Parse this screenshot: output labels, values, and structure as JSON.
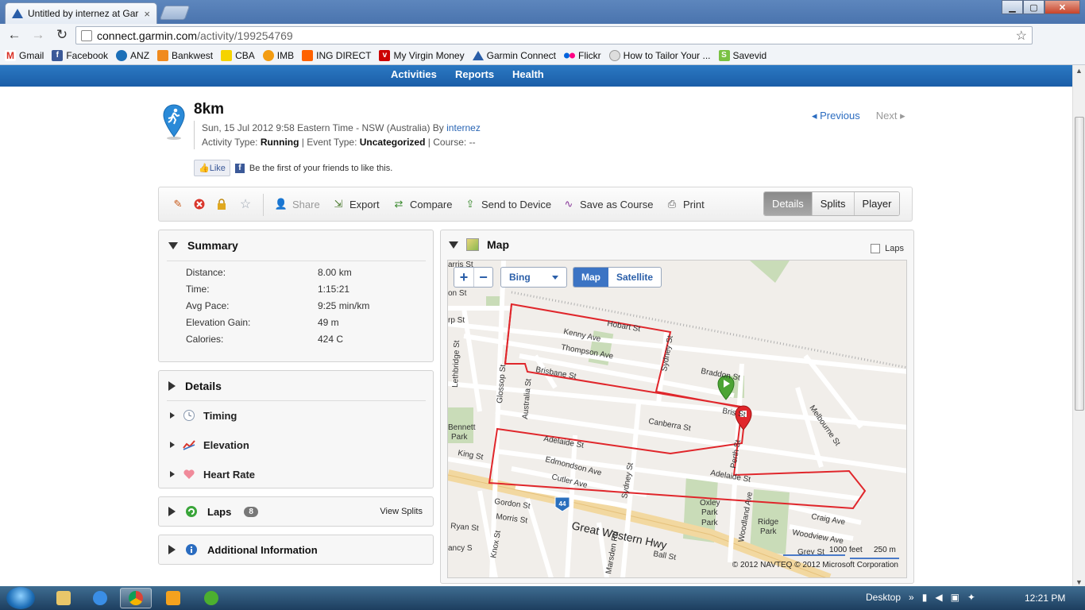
{
  "browser": {
    "tab_title": "Untitled by internez at Garmin Connect",
    "tab_close": "×",
    "url_host": "connect.garmin.com",
    "url_path": "/activity/199254769",
    "bookmarks": [
      "Gmail",
      "Facebook",
      "ANZ",
      "Bankwest",
      "CBA",
      "IMB",
      "ING DIRECT",
      "My Virgin Money",
      "Garmin Connect",
      "Flickr",
      "How to Tailor Your ...",
      "Savevid"
    ]
  },
  "garmin_nav": {
    "activities": "Activities",
    "reports": "Reports",
    "health": "Health"
  },
  "activity": {
    "title": "8km",
    "date_line": "Sun, 15 Jul 2012 9:58 Eastern Time - NSW (Australia) By ",
    "user": "internez",
    "type_label": "Activity Type: ",
    "type_value": "Running",
    "event_label": " | Event Type: ",
    "event_value": "Uncategorized",
    "course_label": " | Course: --",
    "previous": "Previous",
    "next": "Next",
    "like_button": "Like",
    "like_text": "Be the first of your friends to like this."
  },
  "actions": {
    "share": "Share",
    "export": "Export",
    "compare": "Compare",
    "send": "Send to Device",
    "save_course": "Save as Course",
    "print": "Print",
    "tab_details": "Details",
    "tab_splits": "Splits",
    "tab_player": "Player"
  },
  "summary": {
    "title": "Summary",
    "rows": [
      {
        "label": "Distance:",
        "value": "8.00 km"
      },
      {
        "label": "Time:",
        "value": "1:15:21"
      },
      {
        "label": "Avg Pace:",
        "value": "9:25 min/km"
      },
      {
        "label": "Elevation Gain:",
        "value": "49 m"
      },
      {
        "label": "Calories:",
        "value": "424 C"
      }
    ]
  },
  "details": {
    "title": "Details",
    "timing": "Timing",
    "elevation": "Elevation",
    "heart_rate": "Heart Rate"
  },
  "laps": {
    "title": "Laps",
    "count": "8",
    "view_splits": "View Splits"
  },
  "additional": {
    "title": "Additional Information"
  },
  "map": {
    "title": "Map",
    "laps_label": "Laps",
    "provider": "Bing",
    "type_map": "Map",
    "type_satellite": "Satellite",
    "copyright": "© 2012 NAVTEQ © 2012 Microsoft Corporation",
    "scale_feet": "1000 feet",
    "scale_m": "250 m",
    "streets": [
      "Hobart St",
      "Kenny Ave",
      "Thompson Ave",
      "Brisbane St",
      "Braddon St",
      "Canberra St",
      "Adelaide St",
      "Edmondson Ave",
      "Cutler Ave",
      "Sydney St",
      "Perth St",
      "Woodland Ave",
      "Melbourne St",
      "Craig Ave",
      "Woodview Ave",
      "Gordon St",
      "Morris St",
      "Ryan St",
      "Knox St",
      "Marsden Rd",
      "Ball St",
      "Great Western Hwy",
      "King St",
      "Lethbridge St",
      "Glossop St",
      "Australia St",
      "Oxley Park",
      "Ridge Park",
      "Bennett Park",
      "Harris St",
      "44",
      "Grey St"
    ]
  },
  "taskbar": {
    "desktop": "Desktop",
    "time": "12:21 PM"
  }
}
